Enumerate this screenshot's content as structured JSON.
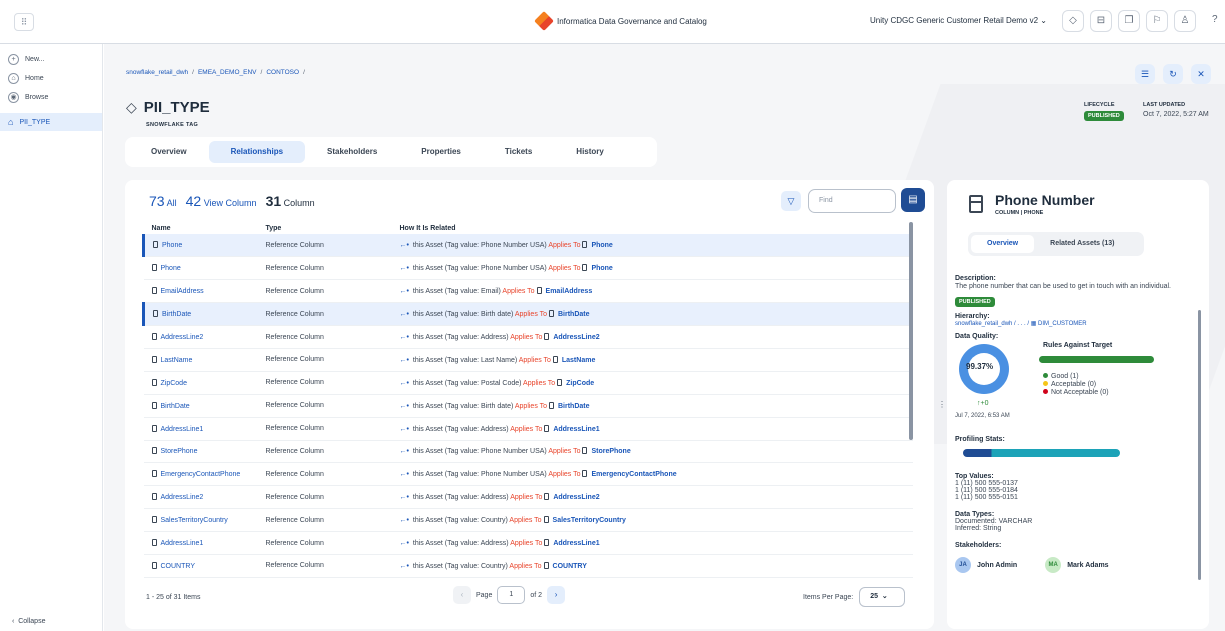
{
  "app": {
    "apps_icon": "grid-icon",
    "brand": "Informatica  Data Governance and Catalog",
    "org": "Unity CDGC Generic Customer Retail Demo v2 ⌄"
  },
  "nav": {
    "items": [
      {
        "icon": "+",
        "label": "New..."
      },
      {
        "icon": "⌂",
        "label": "Home"
      },
      {
        "icon": "◉",
        "label": "Browse"
      }
    ],
    "active_label": "PII_TYPE",
    "collapse": "Collapse"
  },
  "breadcrumb": [
    "snowflake_retail_dwh",
    "/",
    "EMEA_DEMO_ENV",
    "/",
    "CONTOSO",
    "/"
  ],
  "asset": {
    "title": "PII_TYPE",
    "subtitle": "SNOWFLAKE TAG",
    "lifecycle_label": "LIFECYCLE",
    "lifecycle_value": "PUBLISHED",
    "updated_label": "LAST UPDATED",
    "updated_value": "Oct 7, 2022, 5:27 AM"
  },
  "tabs": [
    "Overview",
    "Relationships",
    "Stakeholders",
    "Properties",
    "Tickets",
    "History"
  ],
  "counts": {
    "all_n": "73",
    "all_label": "All",
    "view_n": "42",
    "view_label": "View Column",
    "col_n": "31",
    "col_label": "Column"
  },
  "find_placeholder": "Find",
  "table": {
    "headers": [
      "Name",
      "Type",
      "How It Is Related"
    ],
    "rows": [
      {
        "name": "Phone",
        "type": "Reference Column",
        "relation": "this Asset (Tag value: Phone Number USA)",
        "applies": "Applies To",
        "target": "Phone"
      },
      {
        "name": "Phone",
        "type": "Reference Column",
        "relation": "this Asset (Tag value: Phone Number USA)",
        "applies": "Applies To",
        "target": "Phone"
      },
      {
        "name": "EmailAddress",
        "type": "Reference Column",
        "relation": "this Asset (Tag value: Email)",
        "applies": "Applies To",
        "target": "EmailAddress"
      },
      {
        "name": "BirthDate",
        "type": "Reference Column",
        "relation": "this Asset (Tag value: Birth date)",
        "applies": "Applies To",
        "target": "BirthDate"
      },
      {
        "name": "AddressLine2",
        "type": "Reference Column",
        "relation": "this Asset (Tag value: Address)",
        "applies": "Applies To",
        "target": "AddressLine2"
      },
      {
        "name": "LastName",
        "type": "Reference Column",
        "relation": "this Asset (Tag value: Last Name)",
        "applies": "Applies To",
        "target": "LastName"
      },
      {
        "name": "ZipCode",
        "type": "Reference Column",
        "relation": "this Asset (Tag value: Postal Code)",
        "applies": "Applies To",
        "target": "ZipCode"
      },
      {
        "name": "BirthDate",
        "type": "Reference Column",
        "relation": "this Asset (Tag value: Birth date)",
        "applies": "Applies To",
        "target": "BirthDate"
      },
      {
        "name": "AddressLine1",
        "type": "Reference Column",
        "relation": "this Asset (Tag value: Address)",
        "applies": "Applies To",
        "target": "AddressLine1"
      },
      {
        "name": "StorePhone",
        "type": "Reference Column",
        "relation": "this Asset (Tag value: Phone Number USA)",
        "applies": "Applies To",
        "target": "StorePhone"
      },
      {
        "name": "EmergencyContactPhone",
        "type": "Reference Column",
        "relation": "this Asset (Tag value: Phone Number USA)",
        "applies": "Applies To",
        "target": "EmergencyContactPhone"
      },
      {
        "name": "AddressLine2",
        "type": "Reference Column",
        "relation": "this Asset (Tag value: Address)",
        "applies": "Applies To",
        "target": "AddressLine2"
      },
      {
        "name": "SalesTerritoryCountry",
        "type": "Reference Column",
        "relation": "this Asset (Tag value: Country)",
        "applies": "Applies To",
        "target": "SalesTerritoryCountry"
      },
      {
        "name": "AddressLine1",
        "type": "Reference Column",
        "relation": "this Asset (Tag value: Address)",
        "applies": "Applies To",
        "target": "AddressLine1"
      },
      {
        "name": "COUNTRY",
        "type": "Reference Column",
        "relation": "this Asset (Tag value: Country)",
        "applies": "Applies To",
        "target": "COUNTRY"
      }
    ]
  },
  "footer": {
    "range": "1 - 25 of 31 Items",
    "page_label": "Page",
    "page_value": "1",
    "of_label": "of 2",
    "per_page_label": "Items Per Page:",
    "per_page_value": "25"
  },
  "detail": {
    "title": "Phone Number",
    "subtitle": "COLUMN  |  PHONE",
    "tabs": [
      "Overview",
      "Related Assets (13)"
    ],
    "description_label": "Description:",
    "description": "The phone number that can be used to get in touch with an individual.",
    "badge": "PUBLISHED",
    "hierarchy_label": "Hierarchy:",
    "hierarchy": "snowflake_retail_dwh / . . . / ▦ DIM_CUSTOMER",
    "dq_label": "Data Quality:",
    "dq_value": "99.37%",
    "dq_delta": "↑+0",
    "dq_date": "Jul 7, 2022, 6:53 AM",
    "rules_label": "Rules Against Target",
    "legend_good": "Good (1)",
    "legend_acceptable": "Acceptable (0)",
    "legend_not": "Not Acceptable (0)",
    "profiling_label": "Profiling Stats:",
    "top_values_label": "Top Values:",
    "top_values": [
      "1 (11) 500 555-0137",
      "1 (11) 500 555-0184",
      "1 (11) 500 555-0151"
    ],
    "data_types_label": "Data Types:",
    "documented": "Documented: VARCHAR",
    "inferred": "Inferred: String",
    "stakeholders_label": "Stakeholders:",
    "stakeholders": [
      {
        "initials": "JA",
        "name": "John Admin"
      },
      {
        "initials": "MA",
        "name": "Mark Adams"
      }
    ]
  },
  "colors": {
    "accent": "#1a56b8",
    "published": "#2e8b3a",
    "applies": "#e8442b",
    "dark_button": "#1f4c94"
  }
}
